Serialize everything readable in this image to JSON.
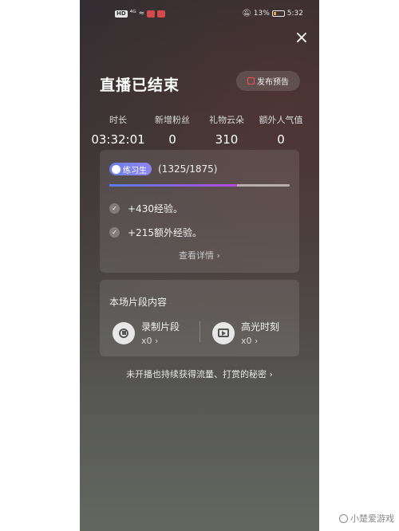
{
  "status_bar": {
    "left_label": "HD",
    "signal_label": "⁴ᴳ",
    "battery_pct": "13%",
    "time": "5:32"
  },
  "header": {
    "title": "直播已结束",
    "preview_button_label": "发布预告",
    "close_label": "×"
  },
  "stats": [
    {
      "label": "时长",
      "value": "03:32:01"
    },
    {
      "label": "新增粉丝",
      "value": "0"
    },
    {
      "label": "礼物云朵",
      "value": "310"
    },
    {
      "label": "额外人气值",
      "value": "0"
    }
  ],
  "level": {
    "badge_label": "练习生",
    "progress_text": "(1325/1875)",
    "progress_fraction": 0.7067,
    "gains": [
      {
        "text": "+430经验。"
      },
      {
        "text": "+215额外经验。"
      }
    ],
    "detail_link": "查看详情 ›"
  },
  "clips": {
    "title": "本场片段内容",
    "items": [
      {
        "name": "录制片段",
        "count": "x0 ›"
      },
      {
        "name": "高光时刻",
        "count": "x0 ›"
      }
    ]
  },
  "footer_link": "未开播也持续获得流量、打赏的秘密 ›",
  "watermark": "小楚爱游戏",
  "colors": {
    "accent_red": "#ff4d4d",
    "progress_start": "#5b7cf0",
    "progress_end": "#b24be0",
    "badge": "#7a82ec"
  }
}
